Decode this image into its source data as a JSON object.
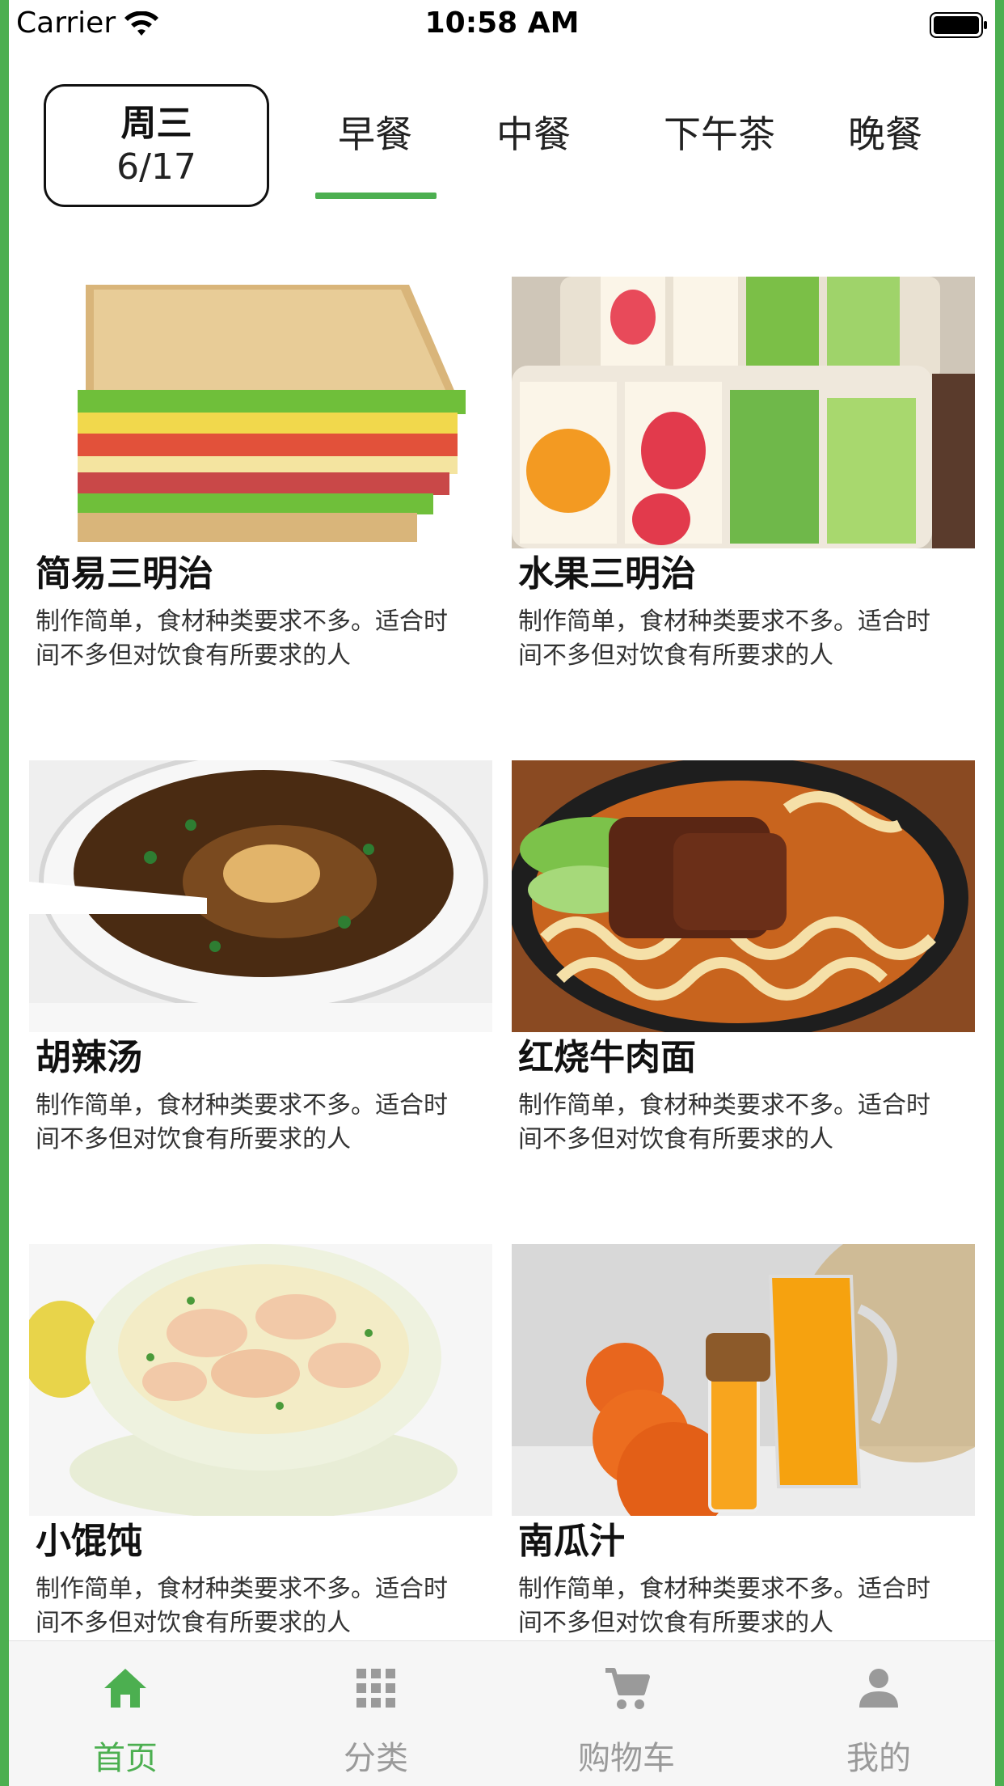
{
  "status_bar": {
    "carrier": "Carrier",
    "time": "10:58 AM"
  },
  "header": {
    "date": {
      "weekday": "周三",
      "date": "6/17"
    },
    "tabs": [
      {
        "label": "早餐",
        "active": true
      },
      {
        "label": "中餐",
        "active": false
      },
      {
        "label": "下午茶",
        "active": false
      },
      {
        "label": "晚餐",
        "active": false
      }
    ]
  },
  "foods": [
    {
      "name": "简易三明治",
      "desc": "制作简单，食材种类要求不多。适合时间不多但对饮食有所要求的人"
    },
    {
      "name": "水果三明治",
      "desc": "制作简单，食材种类要求不多。适合时间不多但对饮食有所要求的人"
    },
    {
      "name": "胡辣汤",
      "desc": "制作简单，食材种类要求不多。适合时间不多但对饮食有所要求的人"
    },
    {
      "name": "红烧牛肉面",
      "desc": "制作简单，食材种类要求不多。适合时间不多但对饮食有所要求的人"
    },
    {
      "name": "小馄饨",
      "desc": "制作简单，食材种类要求不多。适合时间不多但对饮食有所要求的人"
    },
    {
      "name": "南瓜汁",
      "desc": "制作简单，食材种类要求不多。适合时间不多但对饮食有所要求的人"
    }
  ],
  "tabbar": {
    "items": [
      {
        "label": "首页",
        "icon": "home-icon",
        "active": true
      },
      {
        "label": "分类",
        "icon": "grid-icon",
        "active": false
      },
      {
        "label": "购物车",
        "icon": "cart-icon",
        "active": false
      },
      {
        "label": "我的",
        "icon": "person-icon",
        "active": false
      }
    ]
  },
  "colors": {
    "accent": "#4caf50",
    "inactive": "#9a9a9a",
    "text": "#111111"
  }
}
